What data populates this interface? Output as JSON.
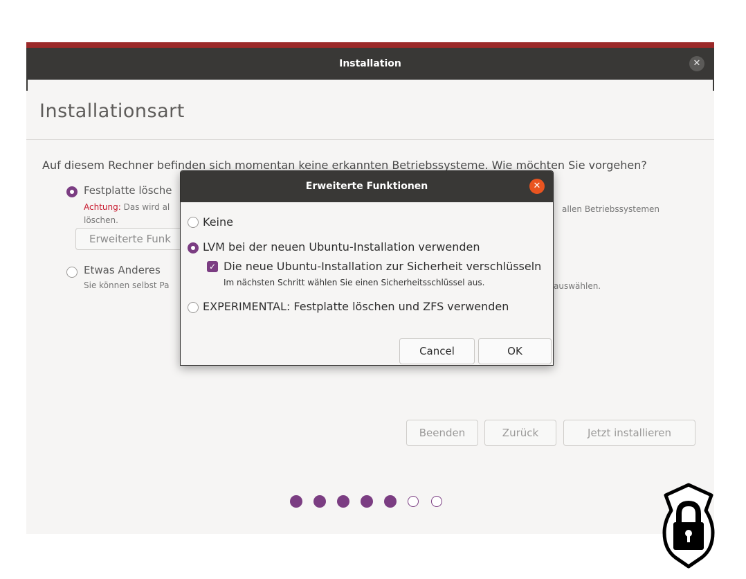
{
  "window": {
    "title": "Installation",
    "close_glyph": "✕",
    "page_title": "Installationsart",
    "question": "Auf diesem Rechner befinden sich momentan keine erkannten Betriebssysteme. Wie möchten Sie vorgehen?"
  },
  "options": {
    "erase": {
      "label": "Festplatte lösche",
      "warning_word": "Achtung:",
      "warning_text": "Das wird al",
      "warning_tail": "allen Betriebssystemen",
      "warning_line2": "löschen.",
      "advanced_button": "Erweiterte Funk"
    },
    "other": {
      "label": "Etwas Anderes",
      "desc": "Sie können selbst Pa",
      "desc_tail": "auswählen."
    }
  },
  "buttons": {
    "quit": "Beenden",
    "back": "Zurück",
    "install": "Jetzt installieren"
  },
  "progress": {
    "steps_total": 7,
    "steps_done": 5
  },
  "dialog": {
    "title": "Erweiterte Funktionen",
    "close_glyph": "✕",
    "opt_none": "Keine",
    "opt_lvm": "LVM bei der neuen Ubuntu-Installation verwenden",
    "encrypt_label": "Die neue Ubuntu-Installation zur Sicherheit verschlüsseln",
    "encrypt_hint": "Im nächsten Schritt wählen Sie einen Sicherheitsschlüssel aus.",
    "opt_zfs": "EXPERIMENTAL: Festplatte löschen und ZFS verwenden",
    "selected": "lvm",
    "encrypt_checked": true,
    "cancel": "Cancel",
    "ok": "OK"
  },
  "colors": {
    "accent": "#7b3d82",
    "warning": "#c7162b",
    "close_active": "#e95420",
    "titlebar": "#393836"
  },
  "icons": {
    "lock_badge": "lock-shield-icon",
    "checkmark": "✓"
  }
}
